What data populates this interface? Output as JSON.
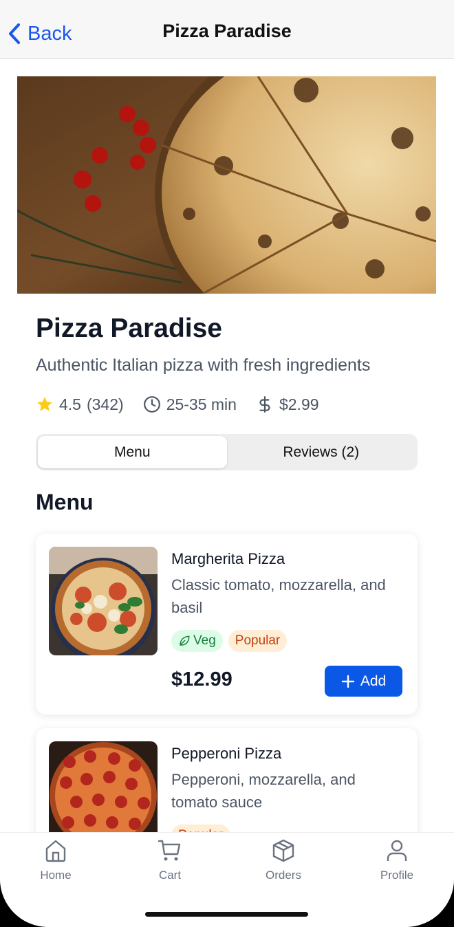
{
  "navbar": {
    "back_label": "Back",
    "title": "Pizza Paradise"
  },
  "restaurant": {
    "name": "Pizza Paradise",
    "description": "Authentic Italian pizza with fresh ingredients",
    "rating": "4.5",
    "rating_count": "(342)",
    "delivery_time": "25-35 min",
    "delivery_fee": "$2.99"
  },
  "tabs": [
    {
      "label": "Menu",
      "active": true
    },
    {
      "label": "Reviews (2)",
      "active": false
    }
  ],
  "menu_section_title": "Menu",
  "menu_items": [
    {
      "name": "Margherita Pizza",
      "description": "Classic tomato, mozzarella, and basil",
      "badges": [
        "Veg",
        "Popular"
      ],
      "price": "$12.99",
      "add_label": "Add"
    },
    {
      "name": "Pepperoni Pizza",
      "description": "Pepperoni, mozzarella, and tomato sauce",
      "badges": [
        "Popular"
      ]
    }
  ],
  "tabbar": [
    {
      "label": "Home",
      "icon": "home-icon"
    },
    {
      "label": "Cart",
      "icon": "cart-icon"
    },
    {
      "label": "Orders",
      "icon": "box-icon"
    },
    {
      "label": "Profile",
      "icon": "user-icon"
    }
  ],
  "colors": {
    "accent": "#0b57e6",
    "star": "#facc15",
    "veg_bg": "#dcfce7",
    "veg_text": "#15803d",
    "popular_bg": "#ffedd5",
    "popular_text": "#c2410c"
  }
}
